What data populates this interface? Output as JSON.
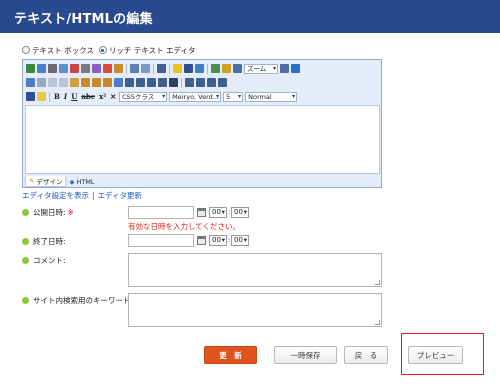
{
  "title": "テキスト/HTMLの編集",
  "editor_mode": {
    "options": [
      "テキスト ボックス",
      "リッチ テキスト エディタ"
    ],
    "selected": "リッチ テキスト エディタ"
  },
  "toolbar": {
    "zoom_label": "ズーム",
    "css_class": "CSSクラス",
    "font_family": "Meiryo, Verd...",
    "font_size": "5",
    "block_format": "Normal"
  },
  "editor_tabs": [
    "デザイン",
    "HTML"
  ],
  "editor_links": [
    "エディタ設定を表示",
    "エディタ更新"
  ],
  "fields": {
    "publish": {
      "label": "公開日時:",
      "required_mark": "※",
      "hour": "00",
      "minute": "00",
      "error": "有効な日時を入力してください。"
    },
    "end": {
      "label": "終了日時:",
      "hour": "00",
      "minute": "00"
    },
    "comment": {
      "label": "コメント:"
    },
    "keywords": {
      "label": "サイト内検索用のキーワード:"
    }
  },
  "time_separator": ":",
  "buttons": {
    "update": "更　新",
    "temp_save": "一時保存",
    "back": "戻　る",
    "preview": "プレビュー"
  },
  "colors": {
    "header": "#2a4a8f",
    "primary_button": "#e0531e",
    "error": "#d9251d",
    "field_bullet": "#8cc63f",
    "highlight": "#e0211d"
  }
}
